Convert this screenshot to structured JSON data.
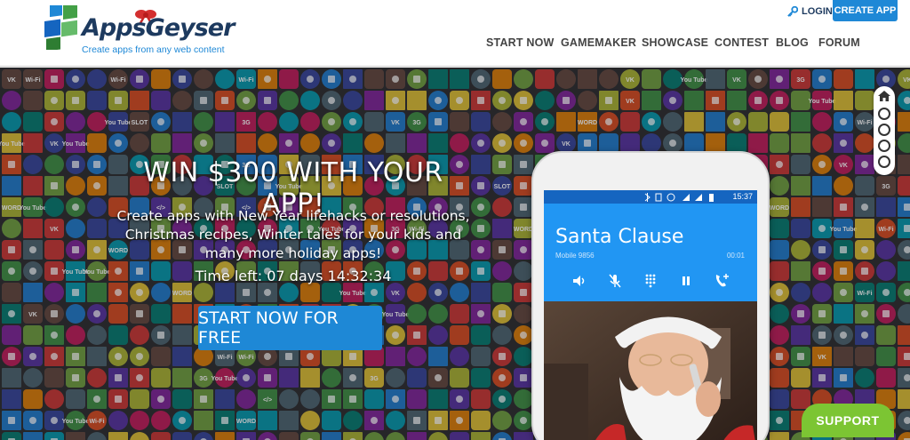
{
  "brand": {
    "name": "AppsGeyser",
    "tagline": "Create apps from any web content",
    "primary_color": "#1e88d6",
    "dark_color": "#1d3a5f",
    "support_color": "#7cc533"
  },
  "header": {
    "login_label": "LOGIN",
    "create_app_label": "CREATE APP",
    "nav": [
      "START NOW",
      "GAMEMAKER",
      "SHOWCASE",
      "CONTEST",
      "BLOG",
      "FORUM"
    ]
  },
  "hero": {
    "title": "WIN $300 WITH YOUR APP!",
    "subtitle": "Create apps with New Year lifehacks or resolutions, Christmas recipes, Winter tales for your kids and many more holiday apps!",
    "time_left": "Time left: 07 days 14:32:34",
    "cta_label": "START NOW FOR FREE"
  },
  "phone": {
    "status_time": "15:37",
    "caller_name": "Santa Clause",
    "caller_line": "Mobile 9856",
    "duration": "00:01",
    "controls": [
      "speaker-icon",
      "mute-icon",
      "dialpad-icon",
      "pause-icon",
      "add-call-icon"
    ]
  },
  "tile_labels": [
    "You Tube",
    "VK",
    "3G",
    "WORD",
    "SLOT",
    "</>",
    "Wi-Fi"
  ],
  "side_nav": {
    "dots": 4
  },
  "support_label": "SUPPORT"
}
